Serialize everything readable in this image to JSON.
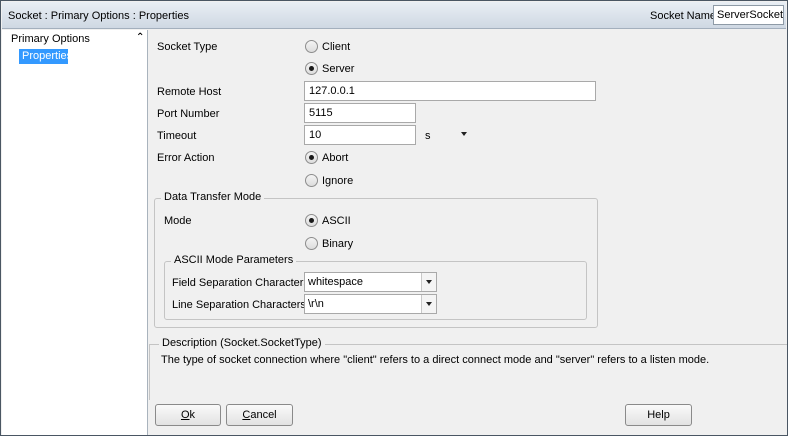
{
  "window": {
    "title": "Socket : Primary Options : Properties",
    "socket_name_label": "Socket Name",
    "socket_name_value": "ServerSocket"
  },
  "nav": {
    "group_label": "Primary Options",
    "collapse_glyph": "⌃",
    "selected_item": "Properties"
  },
  "form": {
    "socket_type_label": "Socket Type",
    "socket_type_options": [
      "Client",
      "Server"
    ],
    "socket_type_selected": "Server",
    "remote_host_label": "Remote Host",
    "remote_host_value": "127.0.0.1",
    "port_label": "Port Number",
    "port_value": "5115",
    "timeout_label": "Timeout",
    "timeout_value": "10",
    "timeout_unit": "s",
    "error_action_label": "Error Action",
    "error_action_options": [
      "Abort",
      "Ignore"
    ],
    "error_action_selected": "Abort"
  },
  "data_transfer": {
    "legend": "Data Transfer Mode",
    "mode_label": "Mode",
    "mode_options": [
      "ASCII",
      "Binary"
    ],
    "mode_selected": "ASCII",
    "ascii_params": {
      "legend": "ASCII Mode Parameters",
      "field_sep_label": "Field Separation Characters",
      "field_sep_value": "whitespace",
      "line_sep_label": "Line Separation Characters",
      "line_sep_value": "\\r\\n"
    }
  },
  "description": {
    "legend": "Description (Socket.SocketType)",
    "text": "The type of socket connection where \"client\" refers to a direct connect mode and \"server\" refers to a listen mode."
  },
  "buttons": {
    "ok_accel": "O",
    "ok_rest": "k",
    "cancel_accel": "C",
    "cancel_rest": "ancel",
    "help": "Help"
  }
}
